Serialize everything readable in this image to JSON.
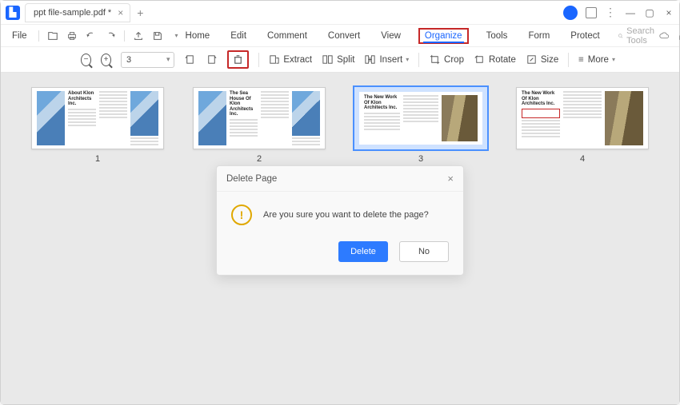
{
  "titlebar": {
    "tab_title": "ppt file-sample.pdf *"
  },
  "menubar": {
    "file": "File",
    "items": [
      "Home",
      "Edit",
      "Comment",
      "Convert",
      "View",
      "Organize",
      "Tools",
      "Form",
      "Protect"
    ],
    "active_index": 5,
    "search_placeholder": "Search Tools"
  },
  "toolbar": {
    "page_value": "3",
    "extract": "Extract",
    "split": "Split",
    "insert": "Insert",
    "crop": "Crop",
    "rotate": "Rotate",
    "size": "Size",
    "more": "More"
  },
  "thumbnails": [
    {
      "num": "1",
      "title": "About Klon Architects Inc.",
      "kind": "blue"
    },
    {
      "num": "2",
      "title": "The Sea House Of Klon Architects Inc.",
      "kind": "blue"
    },
    {
      "num": "3",
      "title": "The New Work Of Klon Architects Inc.",
      "kind": "brown",
      "selected": true
    },
    {
      "num": "4",
      "title": "The New Work Of Klon Architects Inc.",
      "kind": "brown",
      "redbox": true
    }
  ],
  "dialog": {
    "title": "Delete Page",
    "message": "Are you sure you want to delete the page?",
    "confirm": "Delete",
    "cancel": "No"
  }
}
